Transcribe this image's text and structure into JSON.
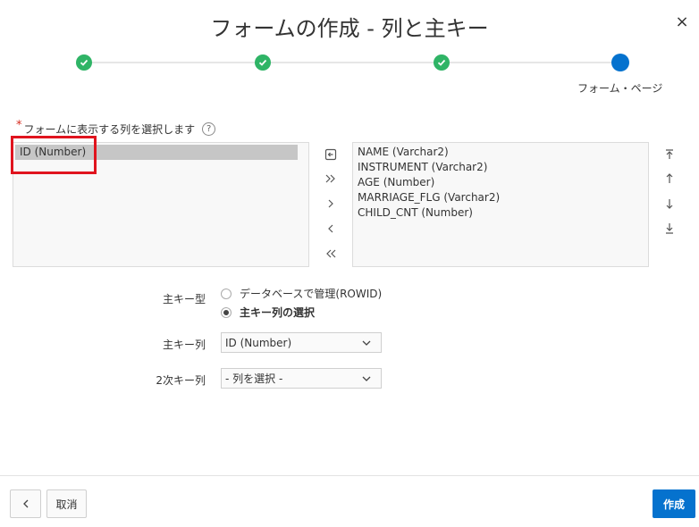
{
  "dialog": {
    "title": "フォームの作成 - 列と主キー",
    "close_glyph": "×"
  },
  "wizard": {
    "current_step_label": "フォーム・ページ",
    "steps_total": 4,
    "current_step": 4,
    "complete_color": "#2fb466",
    "current_color": "#0572ce"
  },
  "columns": {
    "label": "フォームに表示する列を選択します",
    "required_marker": "*",
    "help_glyph": "?",
    "available": [
      "ID (Number)"
    ],
    "selected": [
      "NAME (Varchar2)",
      "INSTRUMENT (Varchar2)",
      "AGE (Number)",
      "MARRIAGE_FLG (Varchar2)",
      "CHILD_CNT (Number)"
    ]
  },
  "pk": {
    "type_label": "主キー型",
    "option_rowid": "データベースで管理(ROWID)",
    "option_columns": "主キー列の選択",
    "selected_option": "主キー列の選択",
    "pk_column_label": "主キー列",
    "pk_column_value": "ID (Number)",
    "secondary_label": "2次キー列",
    "secondary_value": "- 列を選択 -"
  },
  "footer": {
    "back_glyph": "<",
    "cancel_label": "取消",
    "create_label": "作成"
  },
  "highlight_color": "#e0141e"
}
